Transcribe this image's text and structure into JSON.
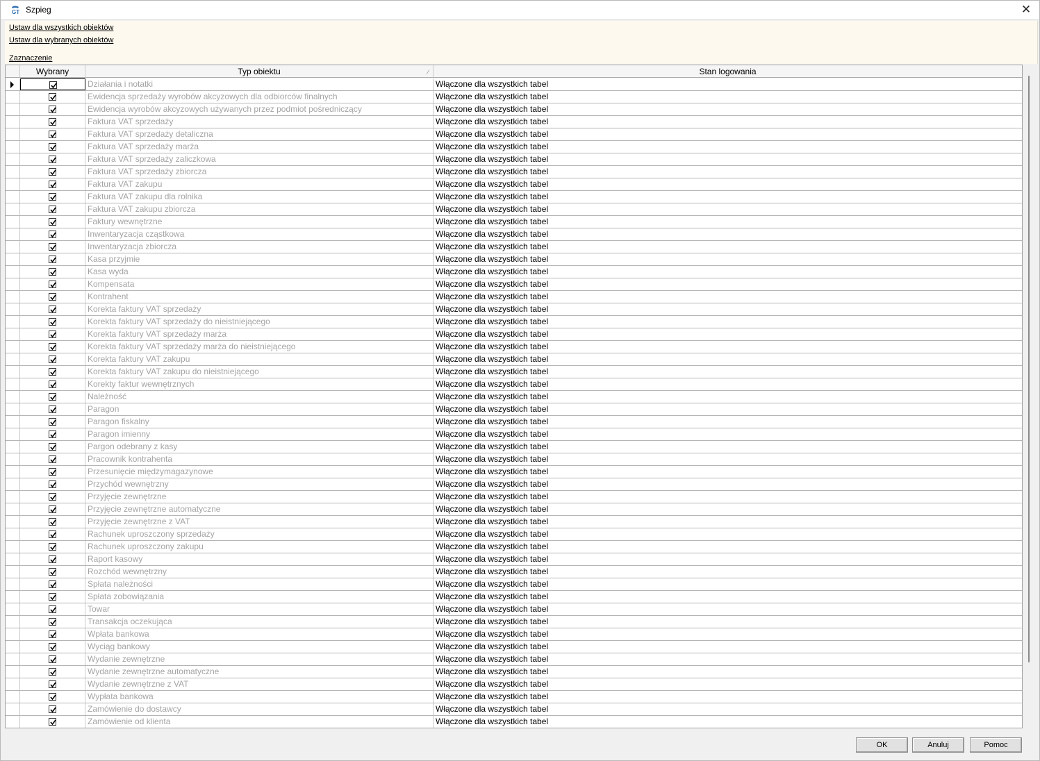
{
  "window": {
    "title": "Szpieg",
    "close_glyph": "✕",
    "icon": "app-icon"
  },
  "toolbar": {
    "set_all": "Ustaw dla wszystkich obiektów",
    "set_selected": "Ustaw dla wybranych obiektów",
    "selection": "Zaznaczenie"
  },
  "grid": {
    "columns": {
      "selected": "Wybrany",
      "type": "Typ obiektu",
      "status": "Stan logowania"
    },
    "rows": [
      {
        "type": "Działania i notatki",
        "status": "Włączone dla wszystkich tabel",
        "checked": true
      },
      {
        "type": "Ewidencja sprzedaży wyrobów akcyzowych dla odbiorców finalnych",
        "status": "Włączone dla wszystkich tabel",
        "checked": true
      },
      {
        "type": "Ewidencja wyrobów akcyzowych używanych przez podmiot pośredniczący",
        "status": "Włączone dla wszystkich tabel",
        "checked": true
      },
      {
        "type": "Faktura VAT sprzedaży",
        "status": "Włączone dla wszystkich tabel",
        "checked": true
      },
      {
        "type": "Faktura VAT sprzedaży detaliczna",
        "status": "Włączone dla wszystkich tabel",
        "checked": true
      },
      {
        "type": "Faktura VAT sprzedaży marża",
        "status": "Włączone dla wszystkich tabel",
        "checked": true
      },
      {
        "type": "Faktura VAT sprzedaży zaliczkowa",
        "status": "Włączone dla wszystkich tabel",
        "checked": true
      },
      {
        "type": "Faktura VAT sprzedaży zbiorcza",
        "status": "Włączone dla wszystkich tabel",
        "checked": true
      },
      {
        "type": "Faktura VAT zakupu",
        "status": "Włączone dla wszystkich tabel",
        "checked": true
      },
      {
        "type": "Faktura VAT zakupu dla rolnika",
        "status": "Włączone dla wszystkich tabel",
        "checked": true
      },
      {
        "type": "Faktura VAT zakupu zbiorcza",
        "status": "Włączone dla wszystkich tabel",
        "checked": true
      },
      {
        "type": "Faktury wewnętrzne",
        "status": "Włączone dla wszystkich tabel",
        "checked": true
      },
      {
        "type": "Inwentaryzacja cząstkowa",
        "status": "Włączone dla wszystkich tabel",
        "checked": true
      },
      {
        "type": "Inwentaryzacja zbiorcza",
        "status": "Włączone dla wszystkich tabel",
        "checked": true
      },
      {
        "type": "Kasa przyjmie",
        "status": "Włączone dla wszystkich tabel",
        "checked": true
      },
      {
        "type": "Kasa wyda",
        "status": "Włączone dla wszystkich tabel",
        "checked": true
      },
      {
        "type": "Kompensata",
        "status": "Włączone dla wszystkich tabel",
        "checked": true
      },
      {
        "type": "Kontrahent",
        "status": "Włączone dla wszystkich tabel",
        "checked": true
      },
      {
        "type": "Korekta faktury VAT sprzedaży",
        "status": "Włączone dla wszystkich tabel",
        "checked": true
      },
      {
        "type": "Korekta faktury VAT sprzedaży do nieistniejącego",
        "status": "Włączone dla wszystkich tabel",
        "checked": true
      },
      {
        "type": "Korekta faktury VAT sprzedaży marża",
        "status": "Włączone dla wszystkich tabel",
        "checked": true
      },
      {
        "type": "Korekta faktury VAT sprzedaży marża do nieistniejącego",
        "status": "Włączone dla wszystkich tabel",
        "checked": true
      },
      {
        "type": "Korekta faktury VAT zakupu",
        "status": "Włączone dla wszystkich tabel",
        "checked": true
      },
      {
        "type": "Korekta faktury VAT zakupu do nieistniejącego",
        "status": "Włączone dla wszystkich tabel",
        "checked": true
      },
      {
        "type": "Korekty faktur wewnętrznych",
        "status": "Włączone dla wszystkich tabel",
        "checked": true
      },
      {
        "type": "Należność",
        "status": "Włączone dla wszystkich tabel",
        "checked": true
      },
      {
        "type": "Paragon",
        "status": "Włączone dla wszystkich tabel",
        "checked": true
      },
      {
        "type": "Paragon fiskalny",
        "status": "Włączone dla wszystkich tabel",
        "checked": true
      },
      {
        "type": "Paragon imienny",
        "status": "Włączone dla wszystkich tabel",
        "checked": true
      },
      {
        "type": "Pargon odebrany z kasy",
        "status": "Włączone dla wszystkich tabel",
        "checked": true
      },
      {
        "type": "Pracownik kontrahenta",
        "status": "Włączone dla wszystkich tabel",
        "checked": true
      },
      {
        "type": "Przesunięcie międzymagazynowe",
        "status": "Włączone dla wszystkich tabel",
        "checked": true
      },
      {
        "type": "Przychód wewnętrzny",
        "status": "Włączone dla wszystkich tabel",
        "checked": true
      },
      {
        "type": "Przyjęcie zewnętrzne",
        "status": "Włączone dla wszystkich tabel",
        "checked": true
      },
      {
        "type": "Przyjęcie zewnętrzne automatyczne",
        "status": "Włączone dla wszystkich tabel",
        "checked": true
      },
      {
        "type": "Przyjęcie zewnętrzne z VAT",
        "status": "Włączone dla wszystkich tabel",
        "checked": true
      },
      {
        "type": "Rachunek uproszczony sprzedaży",
        "status": "Włączone dla wszystkich tabel",
        "checked": true
      },
      {
        "type": "Rachunek uproszczony zakupu",
        "status": "Włączone dla wszystkich tabel",
        "checked": true
      },
      {
        "type": "Raport kasowy",
        "status": "Włączone dla wszystkich tabel",
        "checked": true
      },
      {
        "type": "Rozchód wewnętrzny",
        "status": "Włączone dla wszystkich tabel",
        "checked": true
      },
      {
        "type": "Spłata należności",
        "status": "Włączone dla wszystkich tabel",
        "checked": true
      },
      {
        "type": "Spłata zobowiązania",
        "status": "Włączone dla wszystkich tabel",
        "checked": true
      },
      {
        "type": "Towar",
        "status": "Włączone dla wszystkich tabel",
        "checked": true
      },
      {
        "type": "Transakcja oczekująca",
        "status": "Włączone dla wszystkich tabel",
        "checked": true
      },
      {
        "type": "Wpłata bankowa",
        "status": "Włączone dla wszystkich tabel",
        "checked": true
      },
      {
        "type": "Wyciąg bankowy",
        "status": "Włączone dla wszystkich tabel",
        "checked": true
      },
      {
        "type": "Wydanie zewnętrzne",
        "status": "Włączone dla wszystkich tabel",
        "checked": true
      },
      {
        "type": "Wydanie zewnętrzne automatyczne",
        "status": "Włączone dla wszystkich tabel",
        "checked": true
      },
      {
        "type": "Wydanie zewnętrzne z VAT",
        "status": "Włączone dla wszystkich tabel",
        "checked": true
      },
      {
        "type": "Wypłata bankowa",
        "status": "Włączone dla wszystkich tabel",
        "checked": true
      },
      {
        "type": "Zamówienie do dostawcy",
        "status": "Włączone dla wszystkich tabel",
        "checked": true
      },
      {
        "type": "Zamówienie od klienta",
        "status": "Włączone dla wszystkich tabel",
        "checked": true
      }
    ]
  },
  "buttons": {
    "ok": "OK",
    "cancel": "Anuluj",
    "help": "Pomoc"
  }
}
